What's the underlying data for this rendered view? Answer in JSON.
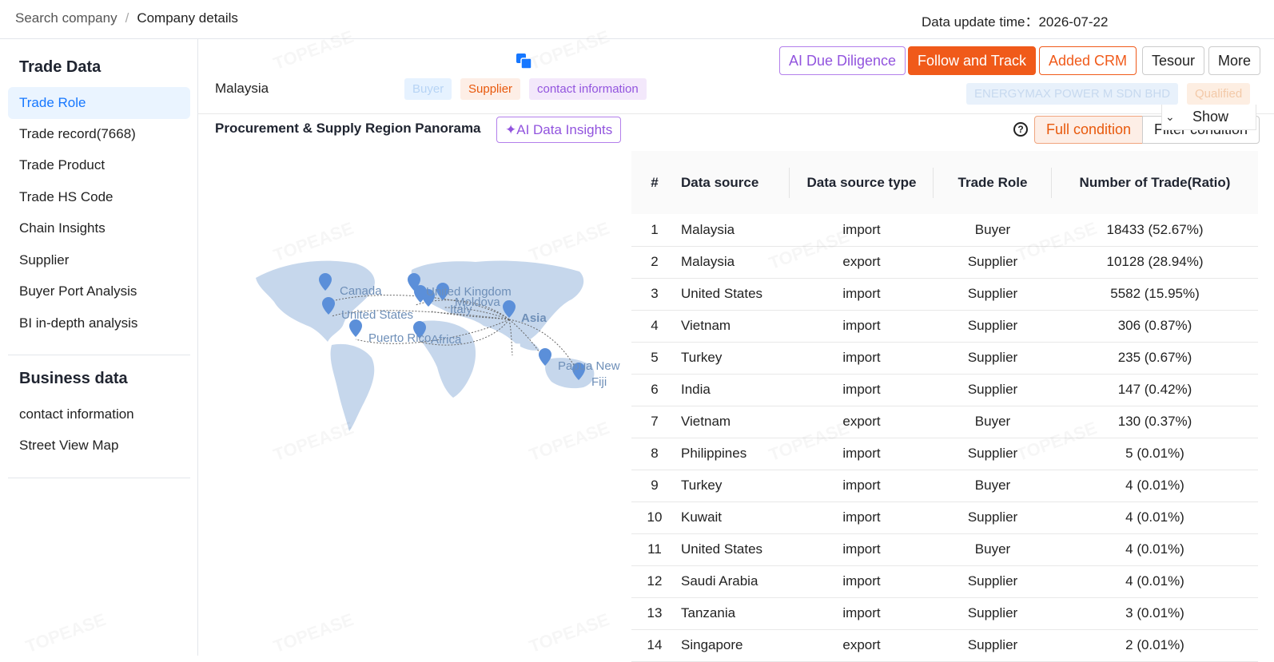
{
  "breadcrumb": {
    "parent": "Search company",
    "separator": "/",
    "current": "Company details"
  },
  "update_time": {
    "label": "Data update time：",
    "value": "2026-07-22"
  },
  "sidebar": {
    "section1_title": "Trade Data",
    "items1": [
      {
        "label": "Trade Role",
        "active": true
      },
      {
        "label": "Trade record(7668)"
      },
      {
        "label": "Trade Product"
      },
      {
        "label": "Trade HS Code"
      },
      {
        "label": "Chain Insights"
      },
      {
        "label": "Supplier"
      },
      {
        "label": "Buyer Port Analysis"
      },
      {
        "label": "BI in-depth analysis"
      }
    ],
    "section2_title": "Business data",
    "items2": [
      {
        "label": "contact information"
      },
      {
        "label": "Street View Map"
      }
    ]
  },
  "company": {
    "country": "Malaysia",
    "tags": [
      "Buyer",
      "Supplier",
      "contact information"
    ],
    "name": "ENERGYMAX POWER M SDN BHD",
    "status": "Qualified"
  },
  "actions": {
    "due_diligence": "AI Due Diligence",
    "follow": "Follow and Track",
    "crm": "Added CRM",
    "tesour": "Tesour",
    "more": "More",
    "show": "Show"
  },
  "panel": {
    "title": "Procurement & Supply Region Panorama",
    "ai_insights": "AI Data Insights",
    "full_condition": "Full condition",
    "filter_condition": "Filter condition"
  },
  "map": {
    "labels": [
      "Canada",
      "United States",
      "Puerto Rico",
      "United Kingdom",
      "Moldova",
      "Italy",
      "Africa",
      "Asia",
      "Papua New",
      "Fiji"
    ]
  },
  "table": {
    "headers": [
      "#",
      "Data source",
      "Data source type",
      "Trade Role",
      "Number of Trade(Ratio)"
    ],
    "rows": [
      {
        "n": "1",
        "source": "Malaysia",
        "type": "import",
        "role": "Buyer",
        "count": "18433 (52.67%)"
      },
      {
        "n": "2",
        "source": "Malaysia",
        "type": "export",
        "role": "Supplier",
        "count": "10128 (28.94%)"
      },
      {
        "n": "3",
        "source": "United States",
        "type": "import",
        "role": "Supplier",
        "count": "5582 (15.95%)"
      },
      {
        "n": "4",
        "source": "Vietnam",
        "type": "import",
        "role": "Supplier",
        "count": "306 (0.87%)"
      },
      {
        "n": "5",
        "source": "Turkey",
        "type": "import",
        "role": "Supplier",
        "count": "235 (0.67%)"
      },
      {
        "n": "6",
        "source": "India",
        "type": "import",
        "role": "Supplier",
        "count": "147 (0.42%)"
      },
      {
        "n": "7",
        "source": "Vietnam",
        "type": "export",
        "role": "Buyer",
        "count": "130 (0.37%)"
      },
      {
        "n": "8",
        "source": "Philippines",
        "type": "import",
        "role": "Supplier",
        "count": "5 (0.01%)"
      },
      {
        "n": "9",
        "source": "Turkey",
        "type": "import",
        "role": "Buyer",
        "count": "4 (0.01%)"
      },
      {
        "n": "10",
        "source": "Kuwait",
        "type": "import",
        "role": "Supplier",
        "count": "4 (0.01%)"
      },
      {
        "n": "11",
        "source": "United States",
        "type": "import",
        "role": "Buyer",
        "count": "4 (0.01%)"
      },
      {
        "n": "12",
        "source": "Saudi Arabia",
        "type": "import",
        "role": "Supplier",
        "count": "4 (0.01%)"
      },
      {
        "n": "13",
        "source": "Tanzania",
        "type": "import",
        "role": "Supplier",
        "count": "3 (0.01%)"
      },
      {
        "n": "14",
        "source": "Singapore",
        "type": "export",
        "role": "Supplier",
        "count": "2 (0.01%)"
      }
    ]
  },
  "watermark": "TOPEASE",
  "colors": {
    "accent": "#1677ff",
    "orange": "#e8590c",
    "purple": "#9254de"
  }
}
